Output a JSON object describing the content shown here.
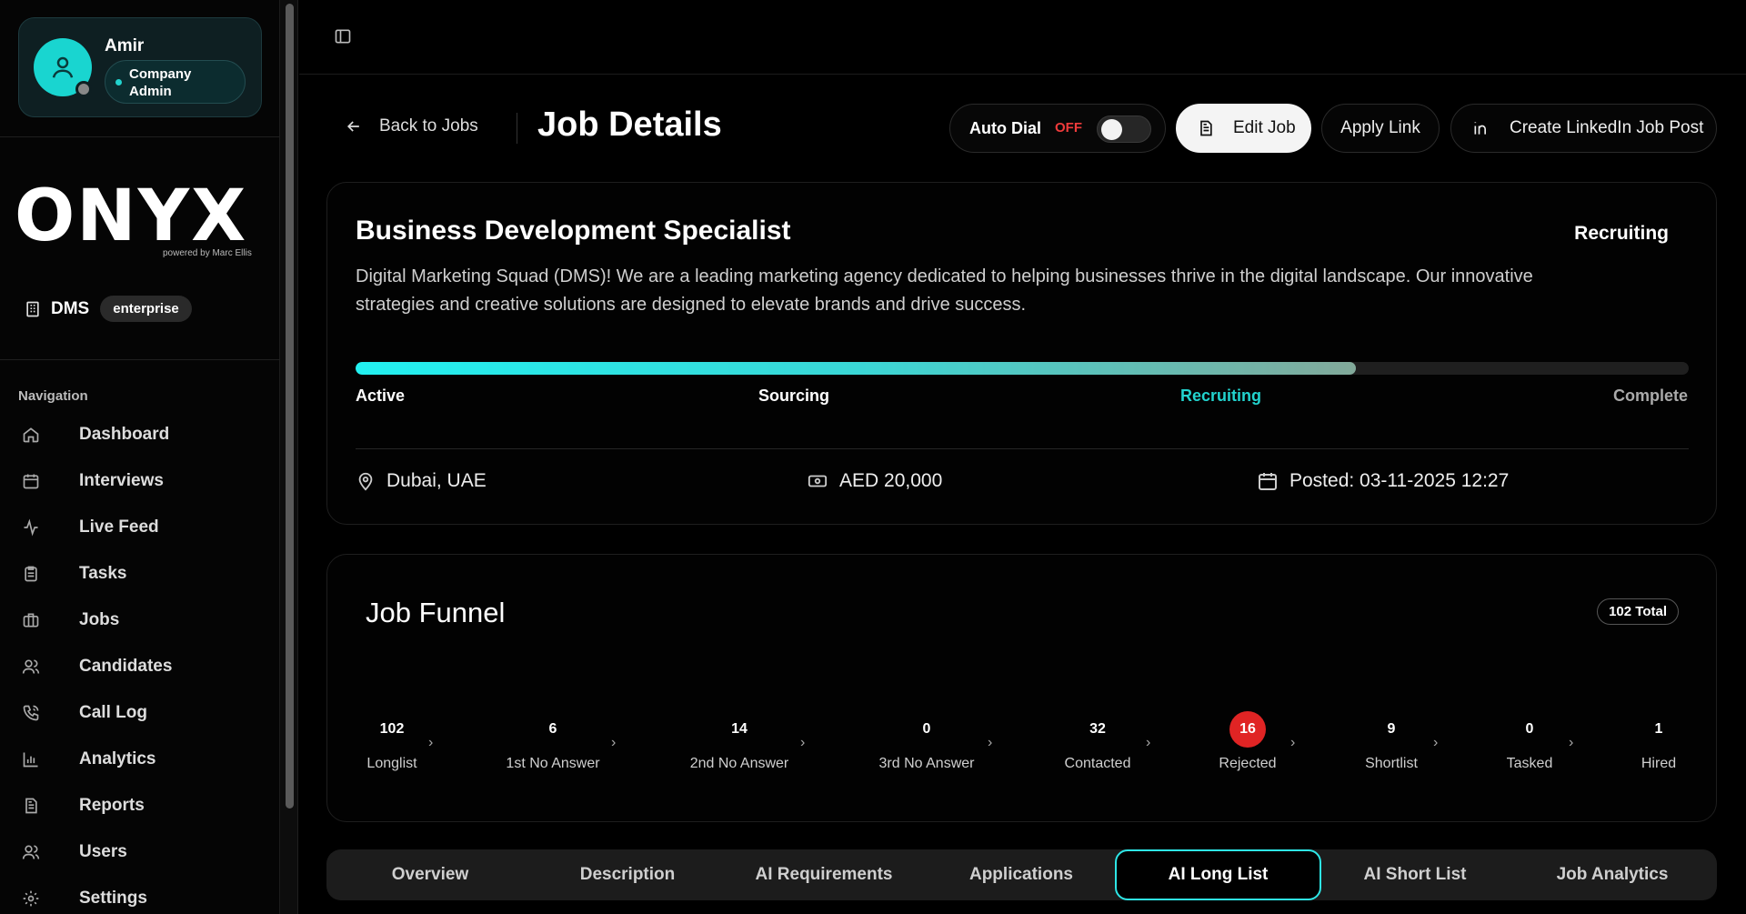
{
  "user": {
    "name": "Amir",
    "role": "Company Admin"
  },
  "logo": {
    "text": "ONYX",
    "sub": "powered by Marc Ellis"
  },
  "org": {
    "name": "DMS",
    "badge": "enterprise"
  },
  "nav": {
    "title": "Navigation",
    "items": [
      {
        "label": "Dashboard",
        "icon": "home-icon"
      },
      {
        "label": "Interviews",
        "icon": "calendar-icon"
      },
      {
        "label": "Live Feed",
        "icon": "activity-icon"
      },
      {
        "label": "Tasks",
        "icon": "clipboard-icon"
      },
      {
        "label": "Jobs",
        "icon": "briefcase-icon"
      },
      {
        "label": "Candidates",
        "icon": "users-icon"
      },
      {
        "label": "Call Log",
        "icon": "phone-icon"
      },
      {
        "label": "Analytics",
        "icon": "bar-chart-icon"
      },
      {
        "label": "Reports",
        "icon": "file-icon"
      },
      {
        "label": "Users",
        "icon": "users-icon"
      },
      {
        "label": "Settings",
        "icon": "gear-icon"
      }
    ]
  },
  "header": {
    "back_label": "Back to Jobs",
    "title": "Job Details",
    "auto_dial_label": "Auto Dial",
    "auto_dial_state": "OFF",
    "edit_label": "Edit Job",
    "apply_label": "Apply Link",
    "linkedin_label": "Create LinkedIn Job Post"
  },
  "job": {
    "title": "Business Development Specialist",
    "status": "Recruiting",
    "description": "Digital Marketing Squad (DMS)! We are a leading marketing agency dedicated to helping businesses thrive in the digital landscape. Our innovative strategies and creative solutions are designed to elevate brands and drive success.",
    "progress": 0.75,
    "stages": [
      "Active",
      "Sourcing",
      "Recruiting",
      "Complete"
    ],
    "location": "Dubai, UAE",
    "salary": "AED 20,000",
    "posted": "Posted: 03-11-2025 12:27"
  },
  "funnel": {
    "title": "Job Funnel",
    "total": "102 Total",
    "stages": [
      {
        "count": "102",
        "label": "Longlist"
      },
      {
        "count": "6",
        "label": "1st No Answer"
      },
      {
        "count": "14",
        "label": "2nd No Answer"
      },
      {
        "count": "0",
        "label": "3rd No Answer"
      },
      {
        "count": "32",
        "label": "Contacted"
      },
      {
        "count": "16",
        "label": "Rejected"
      },
      {
        "count": "9",
        "label": "Shortlist"
      },
      {
        "count": "0",
        "label": "Tasked"
      },
      {
        "count": "1",
        "label": "Hired"
      }
    ]
  },
  "tabs": {
    "items": [
      "Overview",
      "Description",
      "AI Requirements",
      "Applications",
      "AI Long List",
      "AI Short List",
      "Job Analytics"
    ],
    "active": "AI Long List"
  },
  "colors": {
    "accent": "#22d3ce",
    "danger": "#e02424",
    "off": "#ef3b3b"
  }
}
